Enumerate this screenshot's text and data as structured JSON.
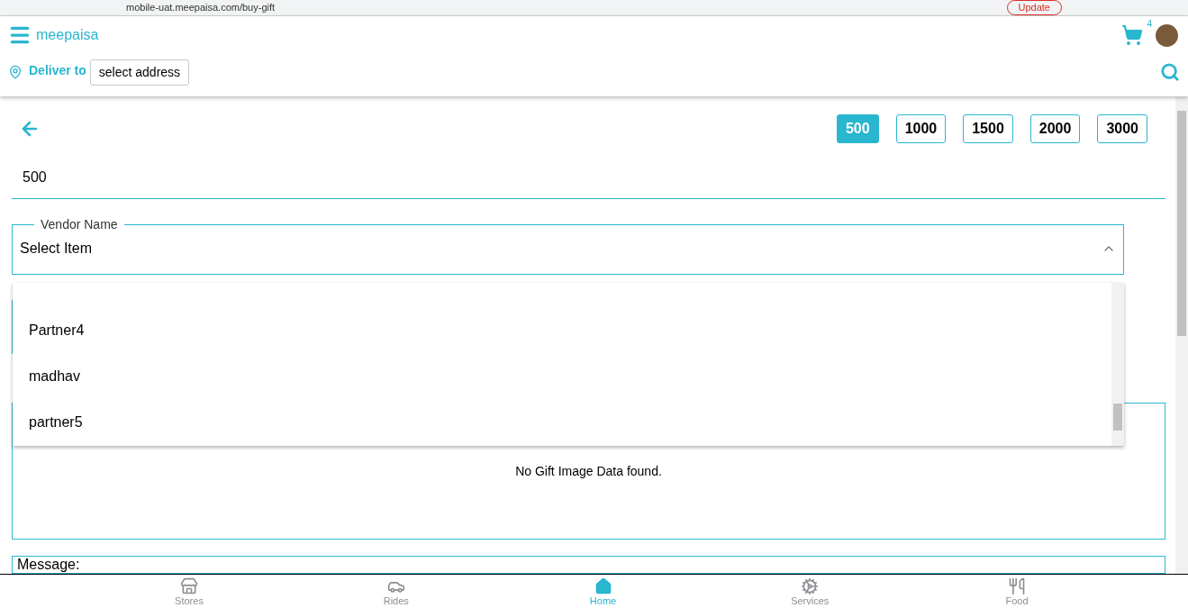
{
  "browser": {
    "url": "mobile-uat.meepaisa.com/buy-gift",
    "update_button": "Update"
  },
  "header": {
    "logo": "meepaisa",
    "cart_count": "4",
    "deliver_label": "Deliver to",
    "address_button": "select address"
  },
  "amounts": [
    {
      "label": "500",
      "selected": true
    },
    {
      "label": "1000",
      "selected": false
    },
    {
      "label": "1500",
      "selected": false
    },
    {
      "label": "2000",
      "selected": false
    },
    {
      "label": "3000",
      "selected": false
    }
  ],
  "amount_value": "500",
  "vendor_field": {
    "label": "Vendor Name",
    "value": "Select Item",
    "expanded": true,
    "options": [
      "Partner4",
      "madhav",
      "partner5"
    ]
  },
  "gift_image_message": "No Gift Image Data found.",
  "message_label": "Message:",
  "bottom_nav": [
    {
      "label": "Stores",
      "selected": false
    },
    {
      "label": "Rides",
      "selected": false
    },
    {
      "label": "Home",
      "selected": true
    },
    {
      "label": "Services",
      "selected": false
    },
    {
      "label": "Food",
      "selected": false
    }
  ]
}
